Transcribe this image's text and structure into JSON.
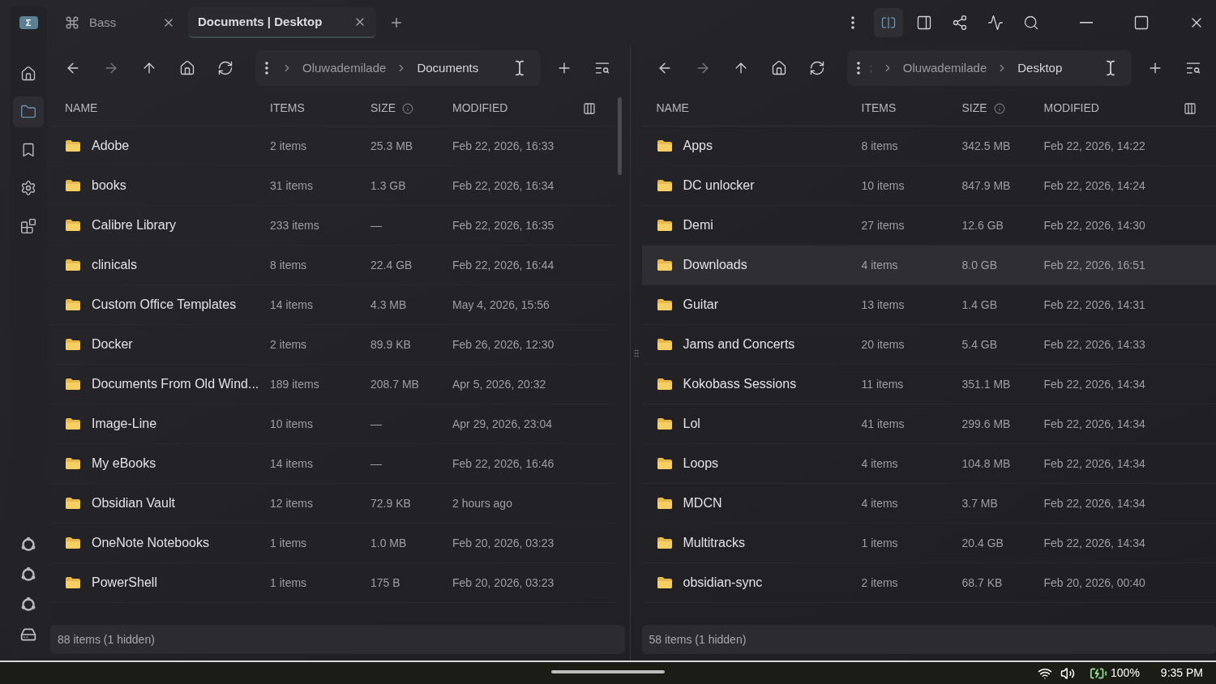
{
  "tabs": [
    {
      "label": "Bass",
      "selected": false,
      "kind": "command"
    },
    {
      "label": "Documents | Desktop",
      "selected": true,
      "kind": "plain"
    }
  ],
  "window_actions": {
    "split_view_on": true
  },
  "panes": [
    {
      "breadcrumbs": [
        "Oluwademilade",
        "Documents"
      ],
      "columns": [
        "NAME",
        "ITEMS",
        "SIZE",
        "MODIFIED"
      ],
      "has_scrollbar": true,
      "rows": [
        {
          "name": "Adobe",
          "items": "2 items",
          "size": "25.3 MB",
          "modified": "Feb 22, 2026, 16:33",
          "selected": false
        },
        {
          "name": "books",
          "items": "31 items",
          "size": "1.3 GB",
          "modified": "Feb 22, 2026, 16:34",
          "selected": false
        },
        {
          "name": "Calibre Library",
          "items": "233 items",
          "size": "—",
          "modified": "Feb 22, 2026, 16:35",
          "selected": false
        },
        {
          "name": "clinicals",
          "items": "8 items",
          "size": "22.4 GB",
          "modified": "Feb 22, 2026, 16:44",
          "selected": false
        },
        {
          "name": "Custom Office Templates",
          "items": "14 items",
          "size": "4.3 MB",
          "modified": "May 4, 2026, 15:56",
          "selected": false
        },
        {
          "name": "Docker",
          "items": "2 items",
          "size": "89.9 KB",
          "modified": "Feb 26, 2026, 12:30",
          "selected": false
        },
        {
          "name": "Documents From Old Wind...",
          "items": "189 items",
          "size": "208.7 MB",
          "modified": "Apr 5, 2026, 20:32",
          "selected": false
        },
        {
          "name": "Image-Line",
          "items": "10 items",
          "size": "—",
          "modified": "Apr 29, 2026, 23:04",
          "selected": false
        },
        {
          "name": "My eBooks",
          "items": "14 items",
          "size": "—",
          "modified": "Feb 22, 2026, 16:46",
          "selected": false
        },
        {
          "name": "Obsidian Vault",
          "items": "12 items",
          "size": "72.9 KB",
          "modified": "2 hours ago",
          "selected": false
        },
        {
          "name": "OneNote Notebooks",
          "items": "1 items",
          "size": "1.0 MB",
          "modified": "Feb 20, 2026, 03:23",
          "selected": false
        },
        {
          "name": "PowerShell",
          "items": "1 items",
          "size": "175 B",
          "modified": "Feb 20, 2026, 03:23",
          "selected": false
        }
      ],
      "status": "88 items (1 hidden)"
    },
    {
      "prefix": ";",
      "breadcrumbs": [
        "Oluwademilade",
        "Desktop"
      ],
      "columns": [
        "NAME",
        "ITEMS",
        "SIZE",
        "MODIFIED"
      ],
      "has_scrollbar": false,
      "rows": [
        {
          "name": "Apps",
          "items": "8 items",
          "size": "342.5 MB",
          "modified": "Feb 22, 2026, 14:22",
          "selected": false
        },
        {
          "name": "DC unlocker",
          "items": "10 items",
          "size": "847.9 MB",
          "modified": "Feb 22, 2026, 14:24",
          "selected": false
        },
        {
          "name": "Demi",
          "items": "27 items",
          "size": "12.6 GB",
          "modified": "Feb 22, 2026, 14:30",
          "selected": false
        },
        {
          "name": "Downloads",
          "items": "4 items",
          "size": "8.0 GB",
          "modified": "Feb 22, 2026, 16:51",
          "selected": true
        },
        {
          "name": "Guitar",
          "items": "13 items",
          "size": "1.4 GB",
          "modified": "Feb 22, 2026, 14:31",
          "selected": false
        },
        {
          "name": "Jams and Concerts",
          "items": "20 items",
          "size": "5.4 GB",
          "modified": "Feb 22, 2026, 14:33",
          "selected": false
        },
        {
          "name": "Kokobass Sessions",
          "items": "11 items",
          "size": "351.1 MB",
          "modified": "Feb 22, 2026, 14:34",
          "selected": false
        },
        {
          "name": "Lol",
          "items": "41 items",
          "size": "299.6 MB",
          "modified": "Feb 22, 2026, 14:34",
          "selected": false
        },
        {
          "name": "Loops",
          "items": "4 items",
          "size": "104.8 MB",
          "modified": "Feb 22, 2026, 14:34",
          "selected": false
        },
        {
          "name": "MDCN",
          "items": "4 items",
          "size": "3.7 MB",
          "modified": "Feb 22, 2026, 14:34",
          "selected": false
        },
        {
          "name": "Multitracks",
          "items": "1 items",
          "size": "20.4 GB",
          "modified": "Feb 22, 2026, 14:34",
          "selected": false
        },
        {
          "name": "obsidian-sync",
          "items": "2 items",
          "size": "68.7 KB",
          "modified": "Feb 20, 2026, 00:40",
          "selected": false
        }
      ],
      "status": "58 items (1 hidden)"
    }
  ],
  "logo": "Σ",
  "sidebar": {
    "items": [
      {
        "kind": "home",
        "selected": false
      },
      {
        "kind": "folder",
        "selected": true
      },
      {
        "kind": "bookmark",
        "selected": false
      },
      {
        "kind": "settings",
        "selected": false
      },
      {
        "kind": "widgets",
        "selected": false
      }
    ],
    "bottom": [
      {
        "kind": "ring"
      },
      {
        "kind": "ring"
      },
      {
        "kind": "ring"
      },
      {
        "kind": "drive"
      }
    ]
  },
  "taskbar": {
    "battery": "100%",
    "time": "9:35 PM"
  }
}
